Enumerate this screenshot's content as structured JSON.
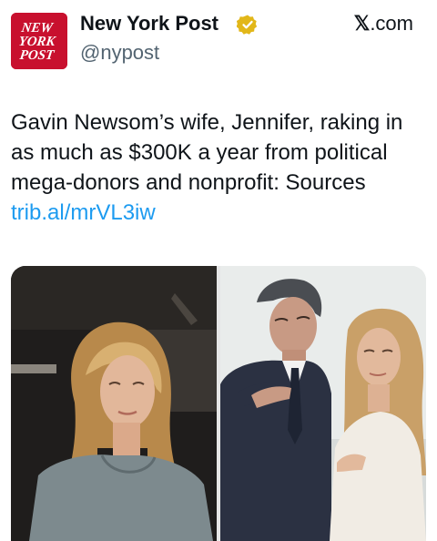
{
  "account": {
    "logo_lines": [
      "NEW",
      "YORK",
      "POST"
    ],
    "display_name": "New York Post",
    "handle": "@nypost",
    "verified_icon": "gold-verified-badge-icon"
  },
  "source": {
    "x_glyph": "𝕏",
    "domain": ".com"
  },
  "tweet": {
    "text": "Gavin Newsom’s wife, Jennifer, raking in as much as $300K a year from political mega-donors and nonprofit: Sources ",
    "link": "trib.al/mrVL3iw"
  },
  "colors": {
    "logo_red": "#c8102e",
    "link_blue": "#1d9bf0",
    "verified_gold": "#e2b719"
  }
}
